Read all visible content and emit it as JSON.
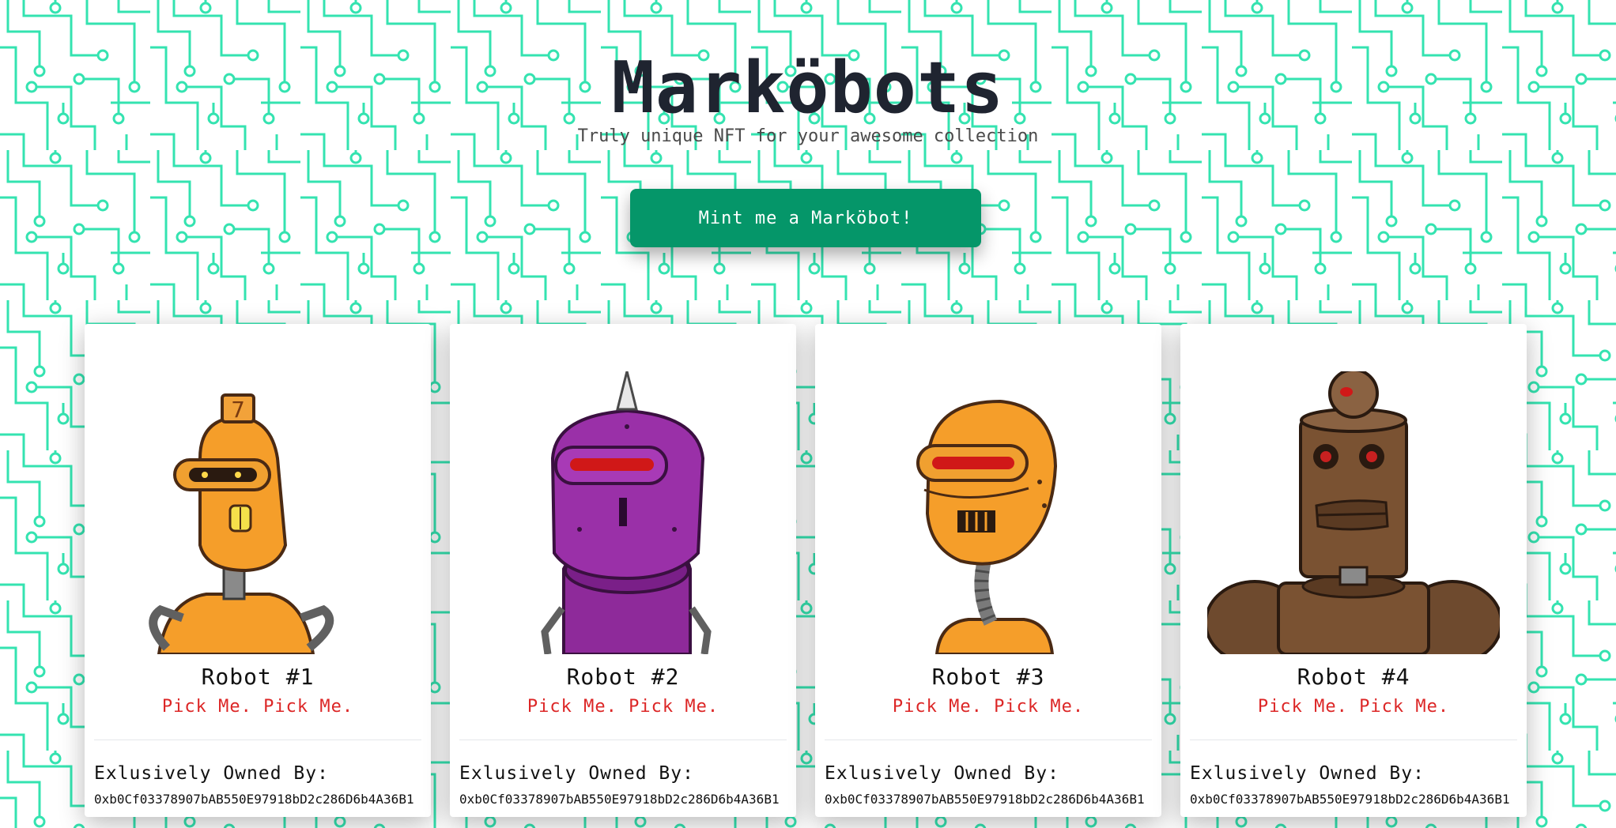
{
  "header": {
    "title": "Marköbots",
    "subtitle": "Truly unique NFT for your awesome collection",
    "mint_button_label": "Mint me a Marköbot!"
  },
  "theme": {
    "accent": "#059669",
    "circuit": "#34e3b0",
    "tagline": "#dc2626"
  },
  "cards": [
    {
      "name": "Robot #1",
      "tagline": "Pick Me. Pick Me.",
      "owner_label": "Exlusively Owned By:",
      "owner_address": "0xb0Cf03378907bAB550E97918bD2c286D6b4A36B1",
      "image_icon": "orange-robot-seven-icon"
    },
    {
      "name": "Robot #2",
      "tagline": "Pick Me. Pick Me.",
      "owner_label": "Exlusively Owned By:",
      "owner_address": "0xb0Cf03378907bAB550E97918bD2c286D6b4A36B1",
      "image_icon": "purple-robot-spike-icon"
    },
    {
      "name": "Robot #3",
      "tagline": "Pick Me. Pick Me.",
      "owner_label": "Exlusively Owned By:",
      "owner_address": "0xb0Cf03378907bAB550E97918bD2c286D6b4A36B1",
      "image_icon": "orange-robot-visor-icon"
    },
    {
      "name": "Robot #4",
      "tagline": "Pick Me. Pick Me.",
      "owner_label": "Exlusively Owned By:",
      "owner_address": "0xb0Cf03378907bAB550E97918bD2c286D6b4A36B1",
      "image_icon": "brown-robot-tower-icon"
    }
  ]
}
